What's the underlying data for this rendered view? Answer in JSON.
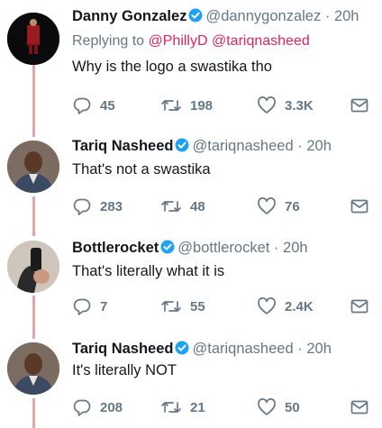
{
  "tweets": [
    {
      "name": "Danny Gonzalez",
      "handle": "@dannygonzalez",
      "dot": "·",
      "time": "20h",
      "replying_prefix": "Replying to",
      "replying_to": [
        "@PhillyD",
        "@tariqnasheed"
      ],
      "text": "Why is the logo a swastika tho",
      "replies": "45",
      "retweets": "198",
      "likes": "3.3K"
    },
    {
      "name": "Tariq Nasheed",
      "handle": "@tariqnasheed",
      "dot": "·",
      "time": "20h",
      "text": "That's not a swastika",
      "replies": "283",
      "retweets": "48",
      "likes": "76"
    },
    {
      "name": "Bottlerocket",
      "handle": "@bottlerocket",
      "dot": "·",
      "time": "20h",
      "text": "That's literally what it is",
      "replies": "7",
      "retweets": "55",
      "likes": "2.4K"
    },
    {
      "name": "Tariq Nasheed",
      "handle": "@tariqnasheed",
      "dot": "·",
      "time": "20h",
      "text": "It's literally NOT",
      "replies": "208",
      "retweets": "21",
      "likes": "50"
    }
  ],
  "icons": {
    "verified": "verified-badge-icon",
    "reply": "reply-icon",
    "retweet": "retweet-icon",
    "like": "heart-icon",
    "dm": "envelope-icon"
  },
  "colors": {
    "verified": "#1da1f2",
    "mention": "#e0245e",
    "muted": "#657786",
    "thread_line": "#e2a6ad"
  }
}
